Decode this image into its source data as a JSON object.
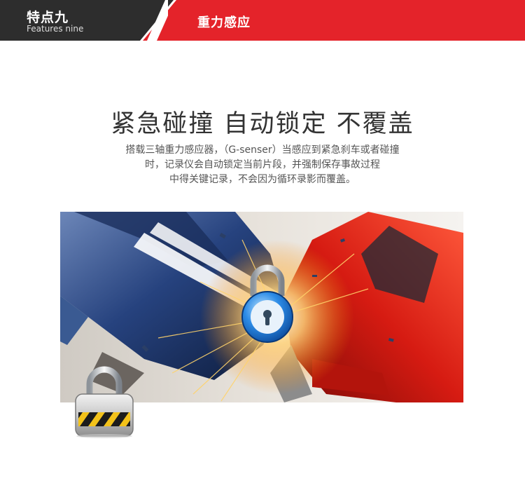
{
  "header": {
    "feature_title": "特点九",
    "feature_subtitle": "Features nine",
    "section_label": "重力感应",
    "colors": {
      "dark": "#2d2d2d",
      "red": "#e4232a"
    }
  },
  "main": {
    "headline": "紧急碰撞 自动锁定 不覆盖",
    "description_lines": [
      "搭载三轴重力感应器，（G-senser）当感应到紧急刹车或者碰撞",
      "时，记录仪会自动锁定当前片段，并强制保存事故过程",
      "中得关键记录，不会因为循环录影而覆盖。"
    ]
  },
  "image": {
    "icons": [
      "blue-padlock-icon",
      "grey-padlock-icon"
    ]
  }
}
